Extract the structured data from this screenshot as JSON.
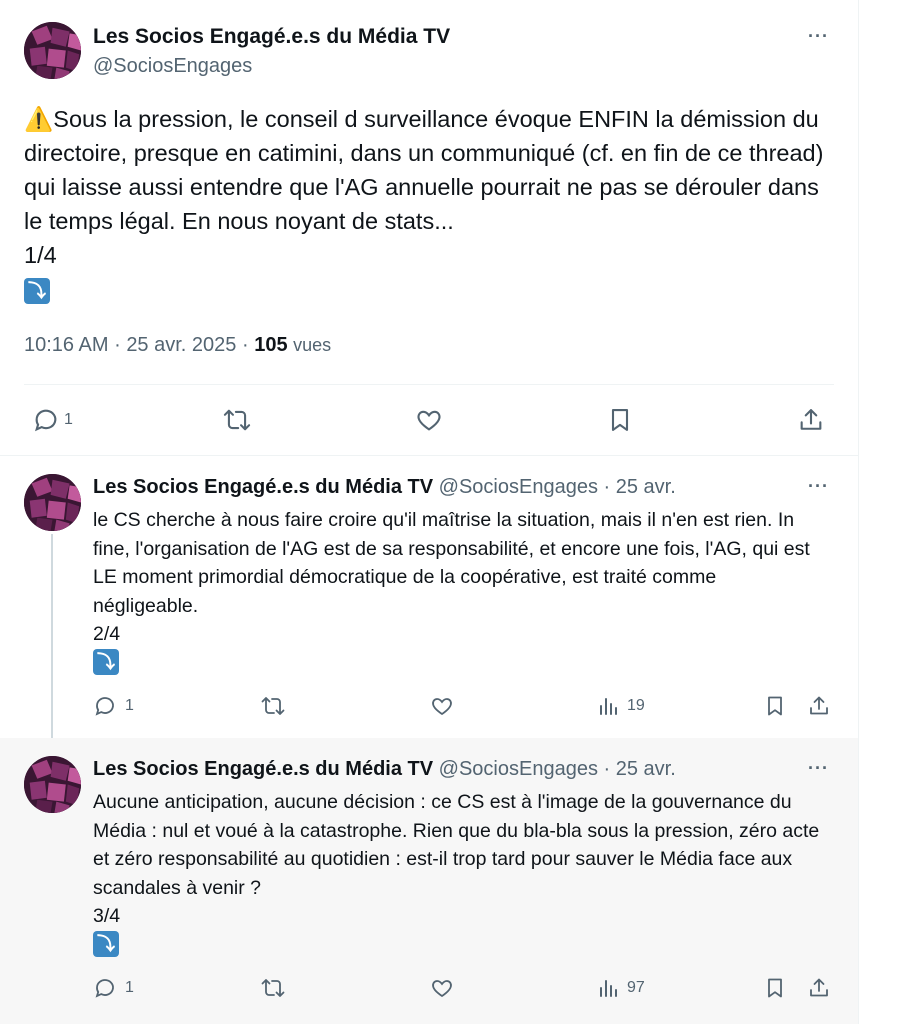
{
  "main_tweet": {
    "author_name": "Les Socios Engagé.e.s du Média TV",
    "author_handle": "@SociosEngages",
    "more_label": "···",
    "warning_emoji": "⚠️",
    "text": "Sous la pression, le conseil d surveillance évoque ENFIN la démission du directoire, presque en catimini, dans un communiqué (cf. en fin de ce thread) qui laisse aussi entendre que l'AG annuelle pourrait ne pas se dérouler dans le temps légal. En nous noyant de stats...\n1/4",
    "thread_emoji": "⤵",
    "time": "10:16 AM",
    "date": "25 avr. 2025",
    "views_count": "105",
    "views_label": "vues",
    "separator": "·",
    "actions": {
      "replies": "1"
    }
  },
  "replies": [
    {
      "author_name": "Les Socios Engagé.e.s du Média TV",
      "author_handle": "@SociosEngages",
      "separator": "·",
      "date": "25 avr.",
      "more_label": "···",
      "text": "le CS cherche à nous faire croire qu'il maîtrise la situation, mais il n'en est rien. In fine, l'organisation de l'AG est de sa responsabilité, et encore une fois, l'AG, qui est LE moment primordial démocratique de la coopérative, est traité comme négligeable.\n2/4",
      "thread_emoji": "⤵",
      "replies": "1",
      "views": "19"
    },
    {
      "author_name": "Les Socios Engagé.e.s du Média TV",
      "author_handle": "@SociosEngages",
      "separator": "·",
      "date": "25 avr.",
      "more_label": "···",
      "text": "Aucune anticipation, aucune décision : ce CS est à l'image de la gouvernance du Média : nul et voué à la catastrophe. Rien que du bla-bla sous la pression, zéro acte et zéro responsabilité au quotidien : est-il trop tard pour sauver le Média face aux scandales à venir ?\n3/4",
      "thread_emoji": "⤵",
      "replies": "1",
      "views": "97"
    }
  ],
  "colors": {
    "text_primary": "#0f1419",
    "text_secondary": "#536471",
    "border": "#eff3f4",
    "hover_bg": "#f7f7f7",
    "emoji_blue": "#3b88c3"
  },
  "icons": [
    "reply-icon",
    "retweet-icon",
    "like-icon",
    "bookmark-icon",
    "share-icon",
    "views-icon",
    "more-icon",
    "warning-icon"
  ]
}
